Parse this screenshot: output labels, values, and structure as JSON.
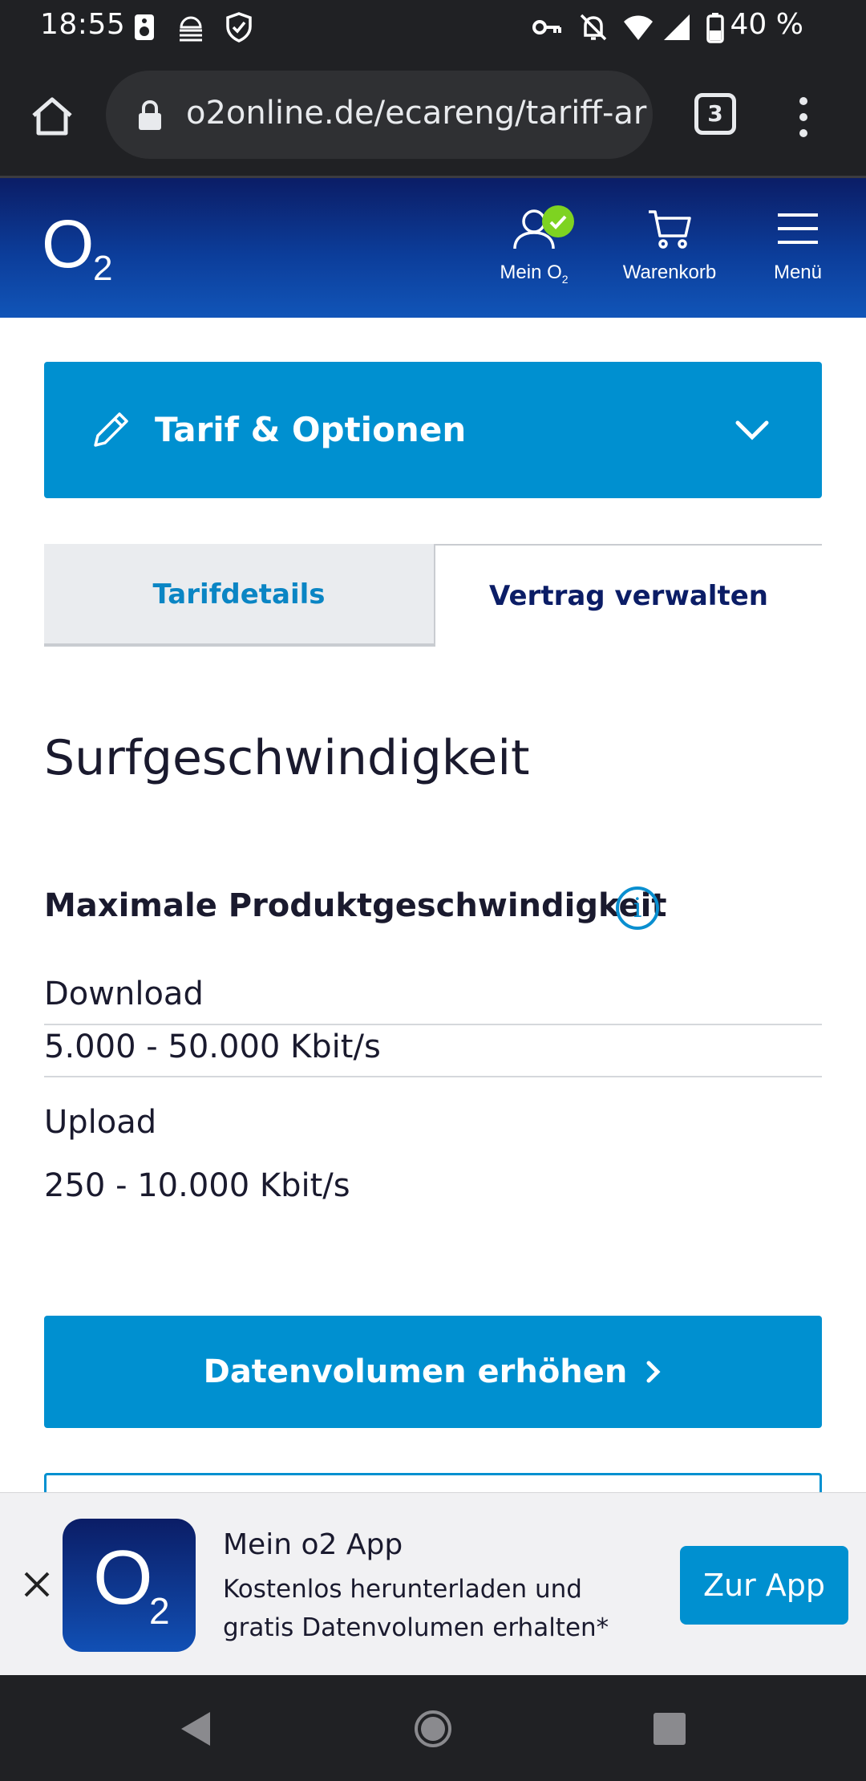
{
  "status_bar": {
    "time": "18:55",
    "battery": "40 %"
  },
  "browser": {
    "url": "o2online.de/ecareng/tariff-ar",
    "tab_count": "3"
  },
  "header": {
    "logo_letter": "O",
    "logo_sub": "2",
    "mein_o2_label": "Mein O",
    "mein_o2_sub": "2",
    "cart_label": "Warenkorb",
    "menu_label": "Menü"
  },
  "accordion": {
    "title": "Tarif & Optionen"
  },
  "tabs": [
    {
      "label": "Tarifdetails",
      "active": false
    },
    {
      "label": "Vertrag verwalten",
      "active": true
    }
  ],
  "content": {
    "section_title": "Surfgeschwindigkeit",
    "sub_heading": "Maximale Produktgeschwindigkeit",
    "info_glyph": "i",
    "download_label": "Download",
    "download_value": "5.000 - 50.000 Kbit/s",
    "upload_label": "Upload",
    "upload_value": "250 - 10.000 Kbit/s",
    "cta_label": "Datenvolumen erhöhen"
  },
  "app_banner": {
    "title": "Mein o2 App",
    "text": "Kostenlos herunterladen und gratis Datenvolumen erhalten*",
    "button": "Zur App",
    "logo_letter": "O",
    "logo_sub": "2"
  },
  "colors": {
    "brand_blue": "#0090d0",
    "header_dark": "#0b1d66",
    "badge_green": "#7ed321"
  }
}
